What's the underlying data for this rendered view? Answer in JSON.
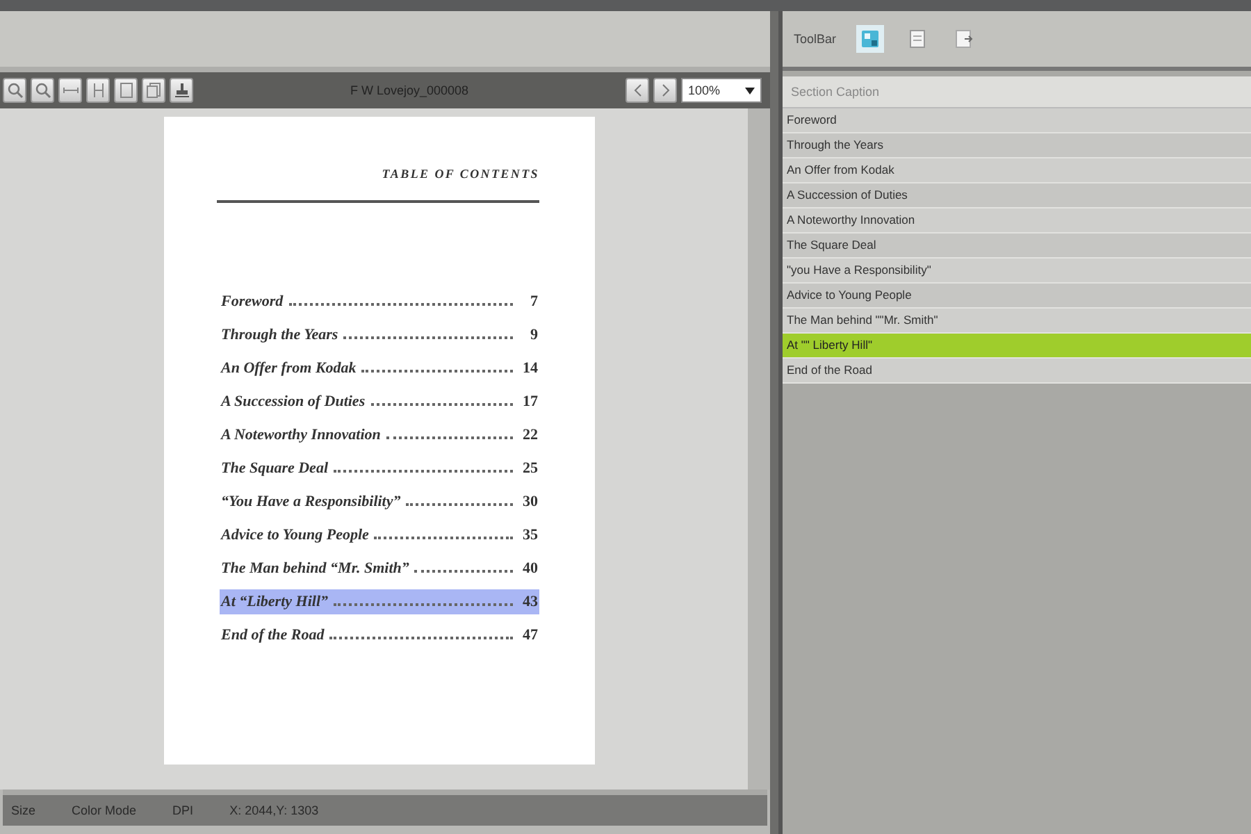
{
  "viewer": {
    "toolbar": {
      "file_name": "F W Lovejoy_000008",
      "zoom": "100%"
    },
    "page": {
      "heading": "TABLE OF CONTENTS",
      "entries": [
        {
          "title": "Foreword",
          "page": "7",
          "selected": false
        },
        {
          "title": "Through the Years",
          "page": "9",
          "selected": false
        },
        {
          "title": "An Offer from Kodak",
          "page": "14",
          "selected": false
        },
        {
          "title": "A Succession of Duties",
          "page": "17",
          "selected": false
        },
        {
          "title": "A Noteworthy Innovation",
          "page": "22",
          "selected": false
        },
        {
          "title": "The Square Deal",
          "page": "25",
          "selected": false
        },
        {
          "title": "“You Have a Responsibility”",
          "page": "30",
          "selected": false
        },
        {
          "title": "Advice to Young People",
          "page": "35",
          "selected": false
        },
        {
          "title": "The Man behind “Mr. Smith”",
          "page": "40",
          "selected": false
        },
        {
          "title": "At “Liberty Hill”",
          "page": "43",
          "selected": true
        },
        {
          "title": "End of the Road",
          "page": "47",
          "selected": false
        }
      ]
    },
    "status_bar": [
      "Size",
      "Color Mode",
      "DPI",
      "X: 2044,Y: 1303"
    ]
  },
  "side_panel": {
    "toolbar_label": "ToolBar",
    "column_header": "Section Caption",
    "sections": [
      {
        "label": "Foreword",
        "selected": false
      },
      {
        "label": "Through the Years",
        "selected": false
      },
      {
        "label": "An Offer from Kodak",
        "selected": false
      },
      {
        "label": "A Succession of Duties",
        "selected": false
      },
      {
        "label": "A Noteworthy Innovation",
        "selected": false
      },
      {
        "label": "The Square Deal",
        "selected": false
      },
      {
        "label": "\"you Have a Responsibility\"",
        "selected": false
      },
      {
        "label": "Advice to Young People",
        "selected": false
      },
      {
        "label": "The Man behind \"\"Mr. Smith\"",
        "selected": false
      },
      {
        "label": "At \"\" Liberty Hill\"",
        "selected": true
      },
      {
        "label": "End of the Road",
        "selected": false
      }
    ]
  }
}
